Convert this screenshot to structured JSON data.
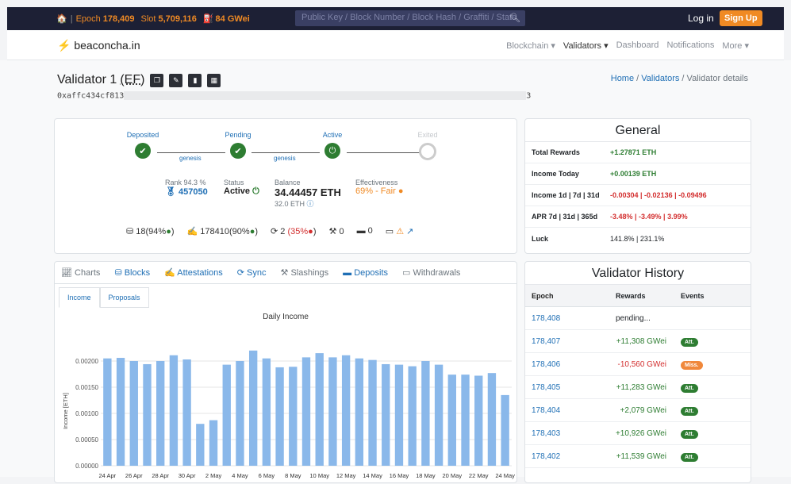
{
  "topbar": {
    "epoch_label": "Epoch",
    "epoch_value": "178,409",
    "slot_label": "Slot",
    "slot_value": "5,709,116",
    "gas": "84 GWei",
    "search_placeholder": "Public Key / Block Number / Block Hash / Graffiti / State",
    "login": "Log in",
    "signup": "Sign Up"
  },
  "nav": {
    "brand": "beaconcha.in",
    "items": [
      "Blockchain ▾",
      "Validators ▾",
      "Dashboard",
      "Notifications",
      "More ▾"
    ]
  },
  "validator": {
    "title": "Validator 1",
    "tag": "(EF)",
    "pubkey_start": "0xaffc434cf813",
    "pubkey_end": "3"
  },
  "breadcrumb": [
    "Home",
    "Validators",
    "Validator details"
  ],
  "lifecycle": {
    "steps": [
      "Deposited",
      "Pending",
      "Active",
      "Exited"
    ],
    "genesis": "genesis",
    "rank_label": "Rank 94.3 %",
    "rank_value": "457050",
    "status_label": "Status",
    "status_value": "Active",
    "balance_label": "Balance",
    "balance_value": "34.44457 ETH",
    "balance_sub": "32.0 ETH",
    "eff_label": "Effectiveness",
    "eff_value": "69% - Fair",
    "proposals": "18(94%",
    "attestations": "178410(90%",
    "sync": "2",
    "sync_pct": "(35%",
    "slashings": "0",
    "deposits": "0"
  },
  "general": {
    "title": "General",
    "rows": [
      {
        "k": "Total Rewards",
        "v": "+1.27871 ETH"
      },
      {
        "k": "Income Today",
        "v": "+0.00139 ETH"
      },
      {
        "k": "Income 1d | 7d | 31d",
        "v": "-0.00304 | -0.02136 | -0.09496"
      },
      {
        "k": "APR 7d | 31d | 365d",
        "v": "-3.48% | -3.49% | 3.99%"
      },
      {
        "k": "Luck",
        "v": "141.8% | 231.1%"
      }
    ]
  },
  "tabs": {
    "items": [
      "Charts",
      "Blocks",
      "Attestations",
      "Sync",
      "Slashings",
      "Deposits",
      "Withdrawals"
    ],
    "subtabs": [
      "Income",
      "Proposals"
    ]
  },
  "chart_data": {
    "type": "bar",
    "title": "Daily Income",
    "ylabel": "Income [ETH]",
    "ylim": [
      0,
      0.0025
    ],
    "yticks": [
      "0.00000",
      "0.00050",
      "0.00100",
      "0.00150",
      "0.00200"
    ],
    "categories": [
      "24 Apr",
      "25 Apr",
      "26 Apr",
      "27 Apr",
      "28 Apr",
      "29 Apr",
      "30 Apr",
      "1 May",
      "2 May",
      "3 May",
      "4 May",
      "5 May",
      "6 May",
      "7 May",
      "8 May",
      "9 May",
      "10 May",
      "11 May",
      "12 May",
      "13 May",
      "14 May",
      "15 May",
      "16 May",
      "17 May",
      "18 May",
      "19 May",
      "20 May",
      "21 May",
      "22 May",
      "23 May",
      "24 May"
    ],
    "xticks": [
      "24 Apr",
      "26 Apr",
      "28 Apr",
      "30 Apr",
      "2 May",
      "4 May",
      "6 May",
      "8 May",
      "10 May",
      "12 May",
      "14 May",
      "16 May",
      "18 May",
      "20 May",
      "22 May",
      "24 May"
    ],
    "values": [
      0.00205,
      0.00206,
      0.002,
      0.00194,
      0.002,
      0.00211,
      0.00203,
      0.0008,
      0.00087,
      0.00193,
      0.002,
      0.0022,
      0.00205,
      0.00188,
      0.00189,
      0.00207,
      0.00215,
      0.00207,
      0.00211,
      0.00205,
      0.00202,
      0.00194,
      0.00193,
      0.0019,
      0.002,
      0.00193,
      0.00174,
      0.00174,
      0.00172,
      0.00177,
      0.00135
    ],
    "color": "#8ab8ea"
  },
  "history": {
    "title": "Validator History",
    "headers": [
      "Epoch",
      "Rewards",
      "Events"
    ],
    "rows": [
      {
        "epoch": "178,408",
        "reward": "pending...",
        "event": ""
      },
      {
        "epoch": "178,407",
        "reward": "+11,308 GWei",
        "event": "Att."
      },
      {
        "epoch": "178,406",
        "reward": "-10,560 GWei",
        "event": "Miss."
      },
      {
        "epoch": "178,405",
        "reward": "+11,283 GWei",
        "event": "Att."
      },
      {
        "epoch": "178,404",
        "reward": "+2,079 GWei",
        "event": "Att."
      },
      {
        "epoch": "178,403",
        "reward": "+10,926 GWei",
        "event": "Att."
      },
      {
        "epoch": "178,402",
        "reward": "+11,539 GWei",
        "event": "Att."
      }
    ]
  }
}
